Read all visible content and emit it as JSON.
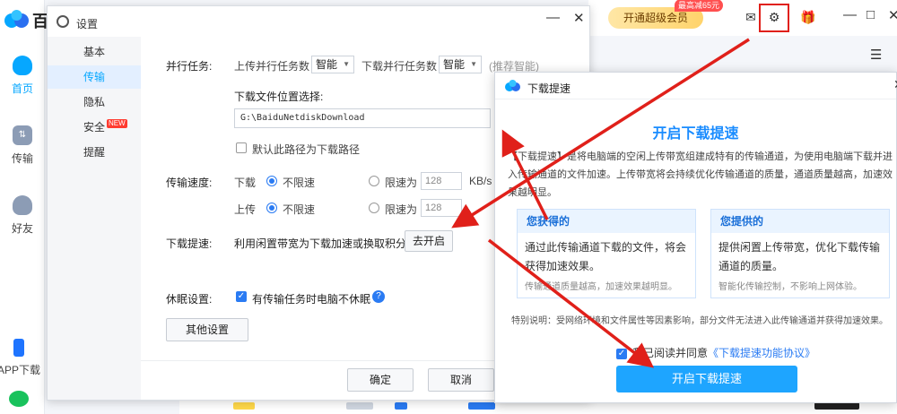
{
  "app": {
    "logo_char": "百",
    "rail": [
      {
        "label": "首页",
        "icon": "cloud-icon"
      },
      {
        "label": "传输",
        "icon": "transfer-icon",
        "glyph": "⇅"
      },
      {
        "label": "好友",
        "icon": "friends-icon"
      },
      {
        "label": "APP下载",
        "icon": "phone-icon"
      },
      {
        "label": "",
        "icon": "chat-icon"
      }
    ],
    "topbar": {
      "vip_label": "开通超级会员",
      "vip_tag": "最高减65元",
      "mail_glyph": "✉",
      "gear_glyph": "⚙",
      "gift_glyph": "🎁",
      "minimize_glyph": "—",
      "maximize_glyph": "□",
      "close_glyph": "✕",
      "list_glyph": "☰"
    }
  },
  "settings": {
    "title": "设置",
    "min_glyph": "—",
    "close_glyph": "✕",
    "nav": [
      {
        "label": "基本"
      },
      {
        "label": "传输",
        "active": true
      },
      {
        "label": "隐私"
      },
      {
        "label": "安全",
        "badge": "NEW"
      },
      {
        "label": "提醒"
      }
    ],
    "parallel": {
      "label": "并行任务:",
      "upload_label": "上传并行任务数",
      "upload_value": "智能",
      "download_label": "下载并行任务数",
      "download_value": "智能",
      "hint": "(推荐智能)",
      "dropdown_glyph": "▼"
    },
    "location": {
      "label": "下载文件位置选择:",
      "path": "G:\\BaiduNetdiskDownload",
      "default_label": "默认此路径为下载路径"
    },
    "speed": {
      "label": "传输速度:",
      "download_label": "下载",
      "upload_label": "上传",
      "unlimited": "不限速",
      "limit_label": "限速为",
      "limit_value": "128",
      "unit": "KB/s"
    },
    "boost": {
      "label": "下载提速:",
      "text": "利用闲置带宽为下载加速或换取积分",
      "button": "去开启"
    },
    "sleep": {
      "label": "休眠设置:",
      "text": "有传输任务时电脑不休眠",
      "check_glyph": "✓",
      "help_glyph": "?"
    },
    "other_button": "其他设置",
    "ok_button": "确定",
    "cancel_button": "取消"
  },
  "speedup": {
    "title": "下载提速",
    "heading": "开启下载提速",
    "description": "【下载提速】是将电脑端的空闲上传带宽组建成特有的传输通道，为使用电脑端下载并进入传输通道的文件加速。上传带宽将会持续优化传输通道的质量，通道质量越高，加速效果越明显。",
    "gain": {
      "title": "您获得的",
      "body": "通过此传输通道下载的文件，将会获得加速效果。",
      "sub": "传输通道质量越高，加速效果越明显。"
    },
    "give": {
      "title": "您提供的",
      "body": "提供闲置上传带宽，优化下载传输通道的质量。",
      "sub": "智能化传输控制，不影响上网体验。"
    },
    "note": "特别说明：受网络环境和文件属性等因素影响，部分文件无法进入此传输通道并获得加速效果。",
    "agree_text": "我已阅读并同意",
    "agree_link": "《下载提速功能协议》",
    "check_glyph": "✓",
    "button": "开启下载提速",
    "close_glyph": "✕"
  }
}
